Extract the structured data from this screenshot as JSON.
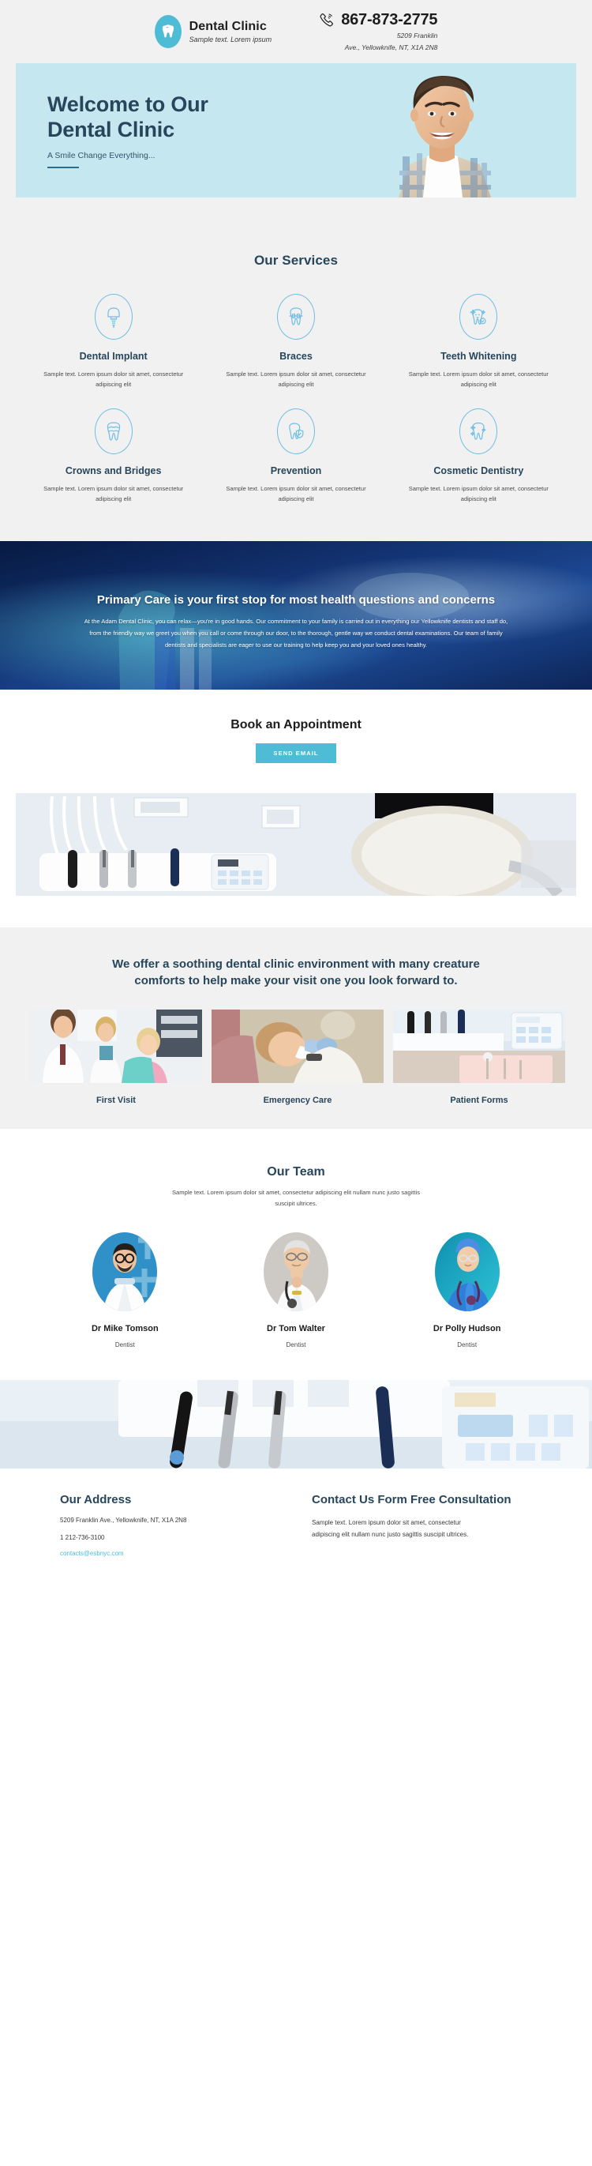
{
  "header": {
    "brand_name": "Dental Clinic",
    "brand_tagline": "Sample text. Lorem ipsum",
    "logo_icon": "tooth-icon",
    "phone_icon": "phone-icon",
    "phone": "867-873-2775",
    "address_line1": "5209 Franklin",
    "address_line2": "Ave., Yellowknife, NT, X1A 2N8"
  },
  "hero": {
    "title_line1": "Welcome to Our",
    "title_line2": "Dental Clinic",
    "subtitle": "A Smile Change Everything...",
    "bg_color": "#c5e7f0",
    "photo_alt": "smiling-young-man"
  },
  "services": {
    "title": "Our Services",
    "items": [
      {
        "icon": "dental-implant-icon",
        "name": "Dental Implant",
        "desc": "Sample text. Lorem ipsum dolor sit amet, consectetur adipiscing elit"
      },
      {
        "icon": "braces-icon",
        "name": "Braces",
        "desc": "Sample text. Lorem ipsum dolor sit amet, consectetur adipiscing elit"
      },
      {
        "icon": "teeth-whitening-icon",
        "name": "Teeth Whitening",
        "desc": "Sample text. Lorem ipsum dolor sit amet, consectetur adipiscing elit"
      },
      {
        "icon": "crowns-bridges-icon",
        "name": "Crowns and Bridges",
        "desc": "Sample text. Lorem ipsum dolor sit amet, consectetur adipiscing elit"
      },
      {
        "icon": "prevention-icon",
        "name": "Prevention",
        "desc": "Sample text. Lorem ipsum dolor sit amet, consectetur adipiscing elit"
      },
      {
        "icon": "cosmetic-dentistry-icon",
        "name": "Cosmetic Dentistry",
        "desc": "Sample text. Lorem ipsum dolor sit amet, consectetur adipiscing elit"
      }
    ]
  },
  "banner": {
    "title": "Primary Care is your first stop for most health questions and concerns",
    "body": "At the Adam Dental Clinic, you can relax—you're in good hands. Our commitment to your family is carried out in everything our Yellowknife dentists and staff do, from the friendly way we greet you when you call or come through our door, to the thorough, gentle way we conduct dental examinations. Our team of family dentists and specialists are eager to use our training to help keep you and your loved ones healthy.",
    "image_alt": "toothbrush-closeup"
  },
  "appointment": {
    "title": "Book an Appointment",
    "button_label": "SEND EMAIL",
    "button_color": "#4fbcd6",
    "image_alt": "dental-chair-and-instruments"
  },
  "comfort": {
    "heading": "We offer a soothing dental clinic environment with many creature comforts to help make your visit one you look forward to.",
    "cards": [
      {
        "label": "First Visit",
        "image_alt": "dentists-with-patient"
      },
      {
        "label": "Emergency Care",
        "image_alt": "dentist-examining-patient"
      },
      {
        "label": "Patient Forms",
        "image_alt": "dental-tools-tray"
      }
    ]
  },
  "team": {
    "title": "Our Team",
    "subtitle": "Sample text. Lorem ipsum dolor sit amet, consectetur adipiscing elit nullam nunc justo sagittis suscipit ultrices.",
    "members": [
      {
        "name": "Dr Mike Tomson",
        "role": "Dentist",
        "image_alt": "male-dentist-glasses"
      },
      {
        "name": "Dr Tom Walter",
        "role": "Dentist",
        "image_alt": "senior-doctor-stethoscope"
      },
      {
        "name": "Dr Polly Hudson",
        "role": "Dentist",
        "image_alt": "female-dentist-blue-scrubs"
      }
    ]
  },
  "footer_banner": {
    "image_alt": "dental-handpieces-and-control-panel"
  },
  "footer": {
    "address_title": "Our Address",
    "address": "5209 Franklin Ave., Yellowknife, NT, X1A 2N8",
    "phone": "1 212-736-3100",
    "email": "contacts@esbnyc.com",
    "contact_title": "Contact Us Form Free Consultation",
    "contact_body": "Sample text. Lorem ipsum dolor sit amet, consectetur adipiscing elit nullam nunc justo sagittis suscipit ultrices."
  }
}
